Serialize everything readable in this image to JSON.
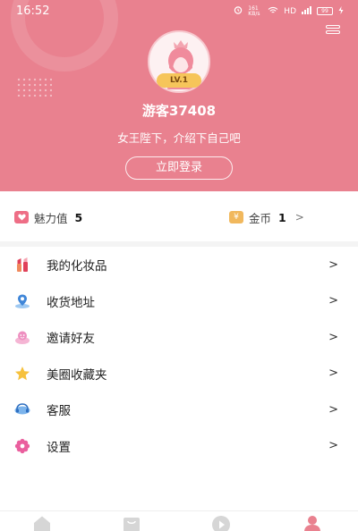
{
  "status_bar": {
    "time": "16:52",
    "network_speed": "161 KB/s",
    "hd": "HD",
    "battery": "99"
  },
  "profile": {
    "level": "LV.1",
    "username": "游客37408",
    "slogan": "女王陛下，介绍下自己吧",
    "login_label": "立即登录"
  },
  "stats": {
    "charm_label": "魅力值",
    "charm_value": "5",
    "coin_symbol": "¥",
    "coin_label": "金币",
    "coin_value": "1",
    "coin_arrow": ">"
  },
  "menu": [
    {
      "label": "我的化妆品",
      "arrow": ">",
      "icon": "lipstick-icon"
    },
    {
      "label": "收货地址",
      "arrow": ">",
      "icon": "location-icon"
    },
    {
      "label": "邀请好友",
      "arrow": ">",
      "icon": "invite-icon"
    },
    {
      "label": "美圈收藏夹",
      "arrow": ">",
      "icon": "star-icon"
    },
    {
      "label": "客服",
      "arrow": ">",
      "icon": "headset-icon"
    },
    {
      "label": "设置",
      "arrow": ">",
      "icon": "gear-icon"
    }
  ],
  "bottom_nav": [
    "home-icon",
    "shop-icon",
    "play-icon",
    "profile-icon"
  ],
  "colors": {
    "header_bg": "#e9818f",
    "accent_pink": "#ee6e86",
    "coin_gold": "#f1b85d"
  }
}
